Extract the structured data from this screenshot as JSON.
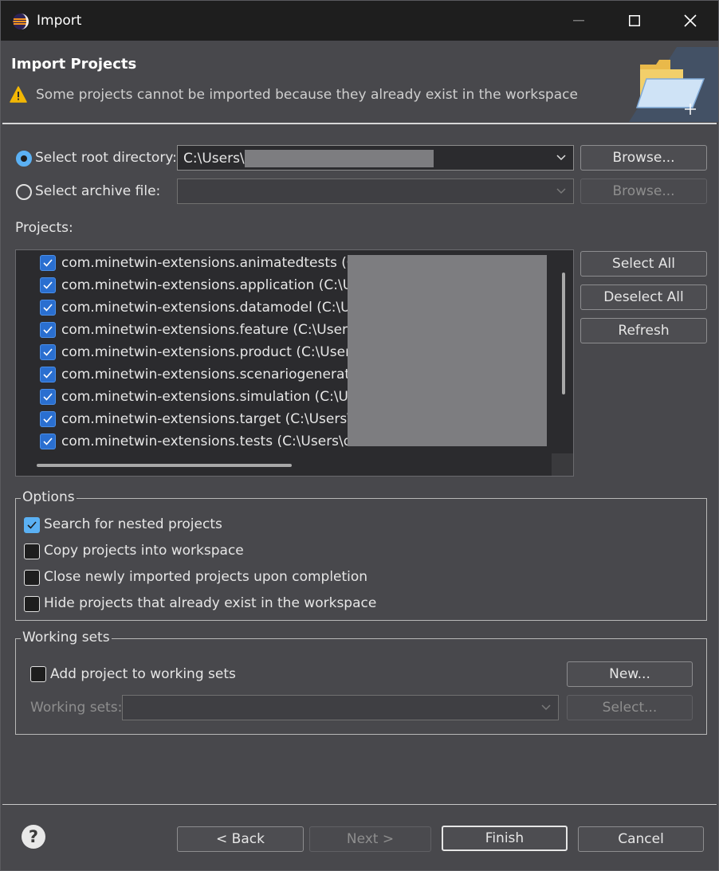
{
  "window": {
    "title": "Import"
  },
  "banner": {
    "title": "Import Projects",
    "message": "Some projects cannot be imported because they already exist in the workspace"
  },
  "source": {
    "root_label": "Select root directory:",
    "root_selected": true,
    "root_value": "C:\\Users\\",
    "archive_label": "Select archive file:",
    "archive_value": "",
    "browse_label": "Browse...",
    "browse_archive_label": "Browse..."
  },
  "projects": {
    "label": "Projects:",
    "items": [
      {
        "name": "com.minetwin-extensions.animatedtests (C:\\U",
        "checked": true
      },
      {
        "name": "com.minetwin-extensions.application (C:\\User",
        "checked": true
      },
      {
        "name": "com.minetwin-extensions.datamodel (C:\\User",
        "checked": true
      },
      {
        "name": "com.minetwin-extensions.feature (C:\\Users\\de",
        "checked": true
      },
      {
        "name": "com.minetwin-extensions.product (C:\\Users\\d",
        "checked": true
      },
      {
        "name": "com.minetwin-extensions.scenariogenerator (",
        "checked": true
      },
      {
        "name": "com.minetwin-extensions.simulation (C:\\Users",
        "checked": true
      },
      {
        "name": "com.minetwin-extensions.target (C:\\Users\\dev",
        "checked": true
      },
      {
        "name": "com.minetwin-extensions.tests (C:\\Users\\devo",
        "checked": true
      }
    ],
    "select_all": "Select All",
    "deselect_all": "Deselect All",
    "refresh": "Refresh"
  },
  "options": {
    "title": "Options",
    "items": [
      {
        "label": "Search for nested projects",
        "checked": true
      },
      {
        "label": "Copy projects into workspace",
        "checked": false
      },
      {
        "label": "Close newly imported projects upon completion",
        "checked": false
      },
      {
        "label": "Hide projects that already exist in the workspace",
        "checked": false
      }
    ]
  },
  "working_sets": {
    "title": "Working sets",
    "add_label": "Add project to working sets",
    "add_checked": false,
    "new_label": "New...",
    "sets_label": "Working sets:",
    "select_label": "Select..."
  },
  "footer": {
    "back": "< Back",
    "next": "Next >",
    "finish": "Finish",
    "cancel": "Cancel",
    "help": "?"
  },
  "colors": {
    "accent": "#5bb1f4",
    "checkbox_blue": "#2a6fd0",
    "warning": "#f2b705",
    "background": "#48484c"
  }
}
